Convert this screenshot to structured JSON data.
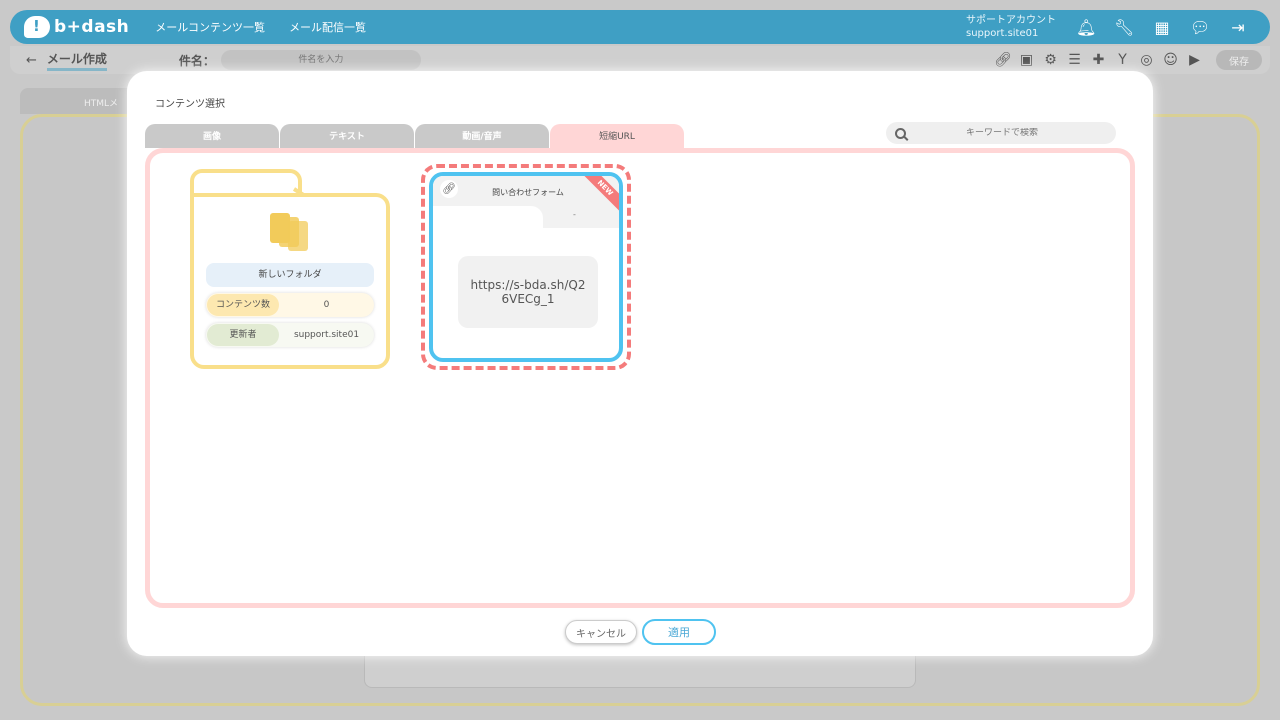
{
  "app": {
    "logo_text": "b+dash",
    "nav": [
      "メールコンテンツ一覧",
      "メール配信一覧"
    ],
    "account_line1": "サポートアカウント",
    "account_line2": "support.site01",
    "header_icons": [
      "bell-icon",
      "wrench-icon",
      "grid-icon",
      "chat-icon",
      "logout-icon"
    ]
  },
  "subbar": {
    "back_symbol": "←",
    "page_title": "メール作成",
    "subject_label": "件名：",
    "subject_placeholder": "件名を入力",
    "tool_icons": [
      "link-icon",
      "calendar-icon",
      "gears-icon",
      "database-icon",
      "add-doc-icon",
      "branch-icon",
      "preview-icon",
      "user-icon",
      "play-icon"
    ],
    "save_label": "保存"
  },
  "background": {
    "editor_tab": "HTMLメ"
  },
  "modal": {
    "title": "コンテンツ選択",
    "tabs": [
      {
        "label": "画像",
        "active": false
      },
      {
        "label": "テキスト",
        "active": false
      },
      {
        "label": "動画/音声",
        "active": false
      },
      {
        "label": "短縮URL",
        "active": true
      }
    ],
    "search_placeholder": "キーワードで検索",
    "folder": {
      "name": "新しいフォルダ",
      "count_label": "コンテンツ数",
      "count_value": "0",
      "updater_label": "更新者",
      "updater_value": "support.site01"
    },
    "url_card": {
      "title": "問い合わせフォーム",
      "subtitle": "-",
      "badge": "NEW",
      "url": "https://s-bda.sh/Q26VECg_1"
    },
    "cancel_label": "キャンセル",
    "apply_label": "適用"
  },
  "colors": {
    "brand_blue": "#3f9fc4",
    "active_tab_pink": "#ffd6d6",
    "folder_yellow": "#f9df8a",
    "selected_border": "#4fc3f0",
    "dashed_red": "#f47b7b"
  }
}
